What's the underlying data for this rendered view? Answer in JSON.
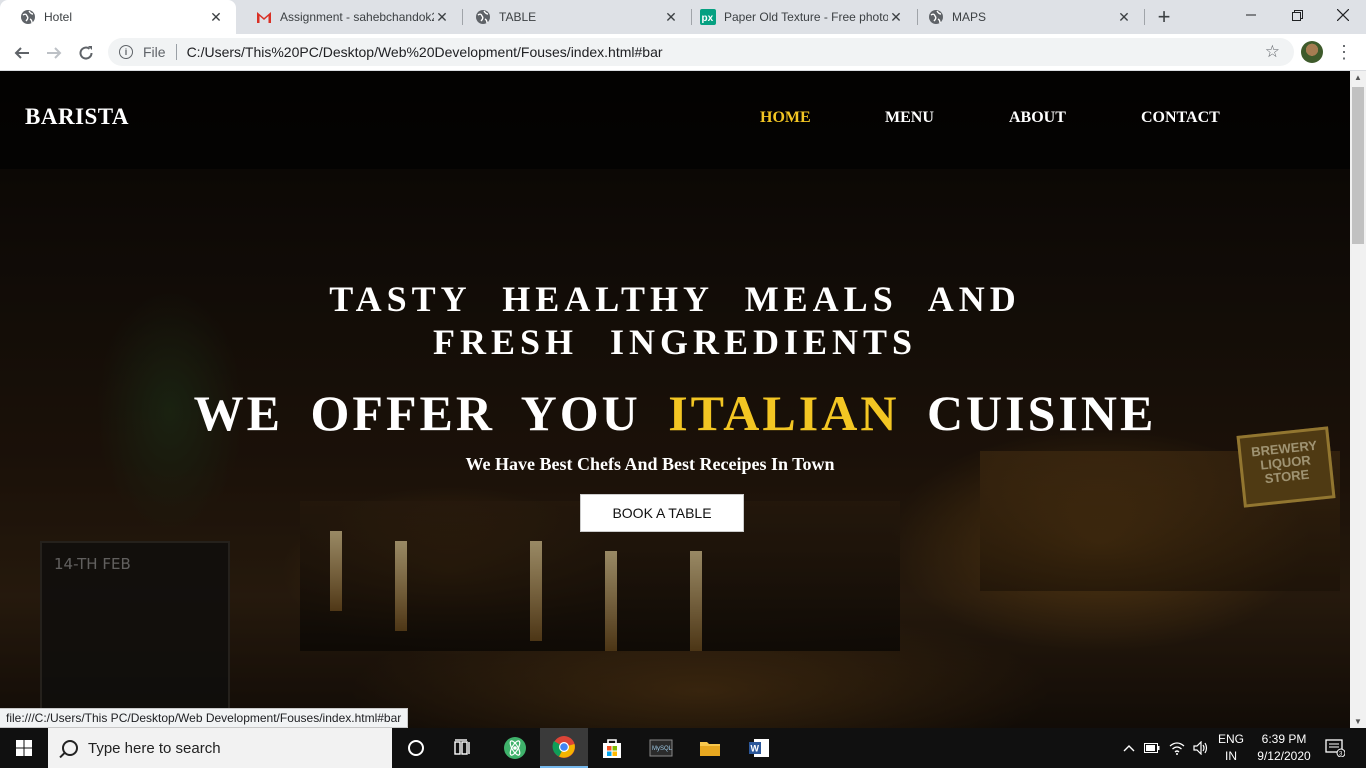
{
  "browser": {
    "tabs": [
      {
        "title": "Hotel",
        "icon": "globe-icon",
        "active": true
      },
      {
        "title": "Assignment - sahebchandok20",
        "icon": "gmail-icon",
        "active": false
      },
      {
        "title": "TABLE",
        "icon": "globe-icon",
        "active": false
      },
      {
        "title": "Paper Old Texture - Free photo",
        "icon": "pexels-icon",
        "active": false
      },
      {
        "title": "MAPS",
        "icon": "globe-icon",
        "active": false
      }
    ],
    "address": {
      "scheme": "File",
      "url": "C:/Users/This%20PC/Desktop/Web%20Development/Fouses/index.html#bar"
    },
    "status_url": "file:///C:/Users/This PC/Desktop/Web Development/Fouses/index.html#bar"
  },
  "site": {
    "brand": "BARISTA",
    "nav": [
      {
        "label": "HOME",
        "active": true
      },
      {
        "label": "MENU",
        "active": false
      },
      {
        "label": "ABOUT",
        "active": false
      },
      {
        "label": "CONTACT",
        "active": false
      }
    ],
    "hero": {
      "line1": "TASTY HEALTHY MEALS AND",
      "line2": "FRESH INGREDIENTS",
      "main_prefix": "WE OFFER YOU",
      "main_accent": "ITALIAN",
      "main_suffix": "CUISINE",
      "subtitle": "We Have Best Chefs And Best Receipes In Town",
      "button": "BOOK A TABLE"
    },
    "scene_texts": {
      "store_sign": "BREWERY LIQUOR STORE",
      "chalkboard": "14-TH FEB"
    },
    "accent_color": "#f3c623"
  },
  "taskbar": {
    "search_placeholder": "Type here to search",
    "language": {
      "line1": "ENG",
      "line2": "IN"
    },
    "time": "6:39 PM",
    "date": "9/12/2020",
    "notifications": "3"
  }
}
